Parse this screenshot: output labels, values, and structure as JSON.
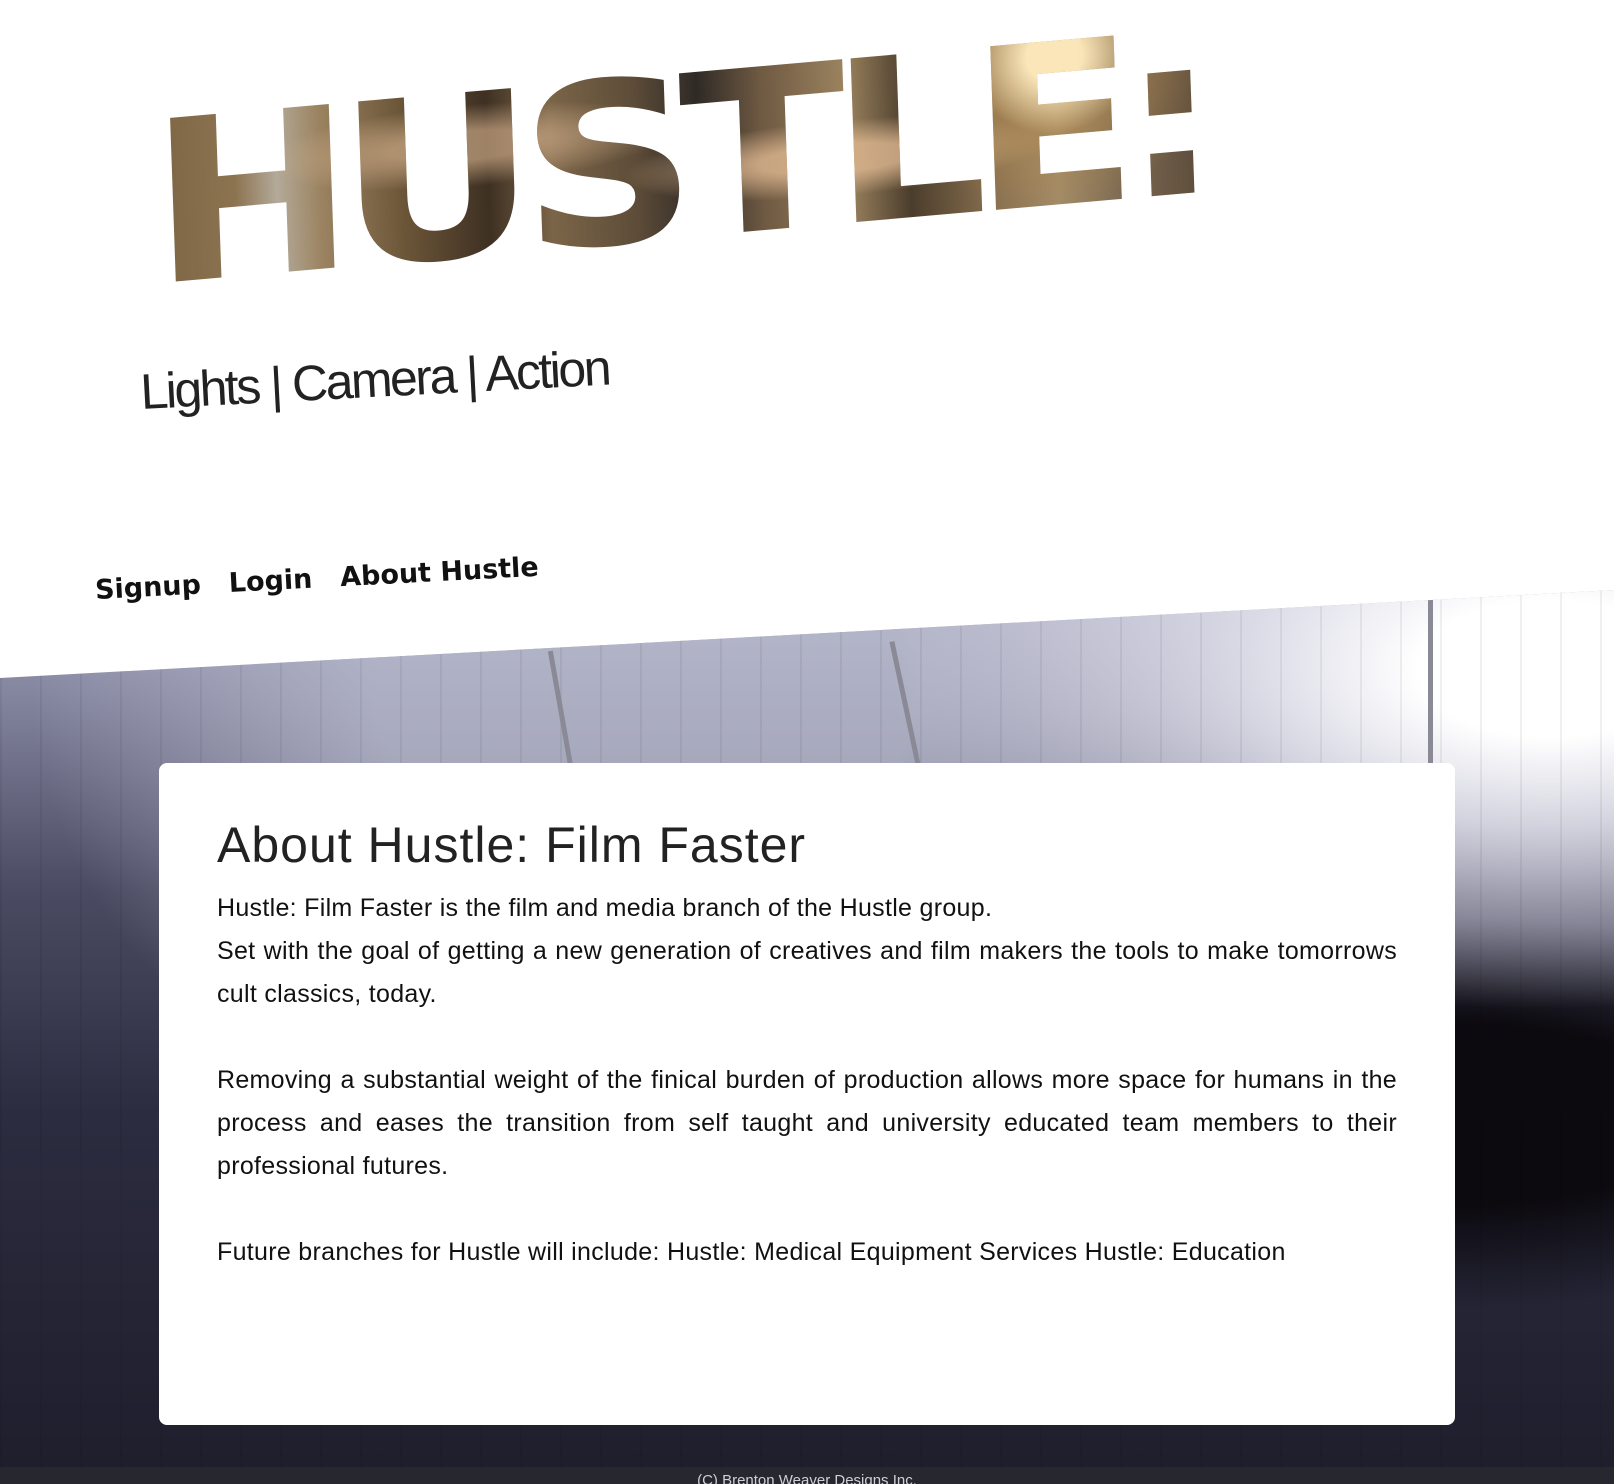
{
  "logo": {
    "text": "HUSTLE:"
  },
  "tagline": "Lights | Camera | Action",
  "nav": {
    "items": [
      {
        "label": "Signup"
      },
      {
        "label": "Login"
      },
      {
        "label": "About Hustle"
      }
    ]
  },
  "about": {
    "title": "About Hustle: Film Faster",
    "paragraphs": [
      {
        "line1": "Hustle: Film Faster is the film and media branch of the Hustle group.",
        "line2": "Set with the goal of getting a new generation of creatives and film makers the tools to make tomorrows cult classics, today."
      },
      {
        "text": "Removing a substantial weight of the finical burden of production allows more space for humans in the process and eases the transition from self taught and university educated team members to their professional futures."
      },
      {
        "text": "Future branches for Hustle will include: Hustle: Medical Equipment Services Hustle: Education"
      }
    ]
  },
  "footer": {
    "text": "(C) Brenton Weaver Designs Inc."
  },
  "colors": {
    "card_bg": "#ffffff",
    "text": "#111111",
    "footer_bg": "#272730"
  }
}
